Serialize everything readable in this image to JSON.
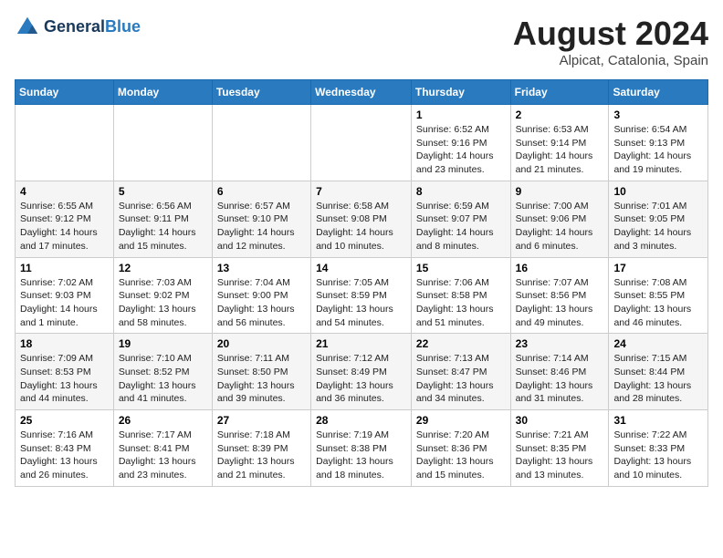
{
  "header": {
    "logo_general": "General",
    "logo_blue": "Blue",
    "month_year": "August 2024",
    "location": "Alpicat, Catalonia, Spain"
  },
  "days_of_week": [
    "Sunday",
    "Monday",
    "Tuesday",
    "Wednesday",
    "Thursday",
    "Friday",
    "Saturday"
  ],
  "weeks": [
    [
      {
        "day": "",
        "info": ""
      },
      {
        "day": "",
        "info": ""
      },
      {
        "day": "",
        "info": ""
      },
      {
        "day": "",
        "info": ""
      },
      {
        "day": "1",
        "info": "Sunrise: 6:52 AM\nSunset: 9:16 PM\nDaylight: 14 hours\nand 23 minutes."
      },
      {
        "day": "2",
        "info": "Sunrise: 6:53 AM\nSunset: 9:14 PM\nDaylight: 14 hours\nand 21 minutes."
      },
      {
        "day": "3",
        "info": "Sunrise: 6:54 AM\nSunset: 9:13 PM\nDaylight: 14 hours\nand 19 minutes."
      }
    ],
    [
      {
        "day": "4",
        "info": "Sunrise: 6:55 AM\nSunset: 9:12 PM\nDaylight: 14 hours\nand 17 minutes."
      },
      {
        "day": "5",
        "info": "Sunrise: 6:56 AM\nSunset: 9:11 PM\nDaylight: 14 hours\nand 15 minutes."
      },
      {
        "day": "6",
        "info": "Sunrise: 6:57 AM\nSunset: 9:10 PM\nDaylight: 14 hours\nand 12 minutes."
      },
      {
        "day": "7",
        "info": "Sunrise: 6:58 AM\nSunset: 9:08 PM\nDaylight: 14 hours\nand 10 minutes."
      },
      {
        "day": "8",
        "info": "Sunrise: 6:59 AM\nSunset: 9:07 PM\nDaylight: 14 hours\nand 8 minutes."
      },
      {
        "day": "9",
        "info": "Sunrise: 7:00 AM\nSunset: 9:06 PM\nDaylight: 14 hours\nand 6 minutes."
      },
      {
        "day": "10",
        "info": "Sunrise: 7:01 AM\nSunset: 9:05 PM\nDaylight: 14 hours\nand 3 minutes."
      }
    ],
    [
      {
        "day": "11",
        "info": "Sunrise: 7:02 AM\nSunset: 9:03 PM\nDaylight: 14 hours\nand 1 minute."
      },
      {
        "day": "12",
        "info": "Sunrise: 7:03 AM\nSunset: 9:02 PM\nDaylight: 13 hours\nand 58 minutes."
      },
      {
        "day": "13",
        "info": "Sunrise: 7:04 AM\nSunset: 9:00 PM\nDaylight: 13 hours\nand 56 minutes."
      },
      {
        "day": "14",
        "info": "Sunrise: 7:05 AM\nSunset: 8:59 PM\nDaylight: 13 hours\nand 54 minutes."
      },
      {
        "day": "15",
        "info": "Sunrise: 7:06 AM\nSunset: 8:58 PM\nDaylight: 13 hours\nand 51 minutes."
      },
      {
        "day": "16",
        "info": "Sunrise: 7:07 AM\nSunset: 8:56 PM\nDaylight: 13 hours\nand 49 minutes."
      },
      {
        "day": "17",
        "info": "Sunrise: 7:08 AM\nSunset: 8:55 PM\nDaylight: 13 hours\nand 46 minutes."
      }
    ],
    [
      {
        "day": "18",
        "info": "Sunrise: 7:09 AM\nSunset: 8:53 PM\nDaylight: 13 hours\nand 44 minutes."
      },
      {
        "day": "19",
        "info": "Sunrise: 7:10 AM\nSunset: 8:52 PM\nDaylight: 13 hours\nand 41 minutes."
      },
      {
        "day": "20",
        "info": "Sunrise: 7:11 AM\nSunset: 8:50 PM\nDaylight: 13 hours\nand 39 minutes."
      },
      {
        "day": "21",
        "info": "Sunrise: 7:12 AM\nSunset: 8:49 PM\nDaylight: 13 hours\nand 36 minutes."
      },
      {
        "day": "22",
        "info": "Sunrise: 7:13 AM\nSunset: 8:47 PM\nDaylight: 13 hours\nand 34 minutes."
      },
      {
        "day": "23",
        "info": "Sunrise: 7:14 AM\nSunset: 8:46 PM\nDaylight: 13 hours\nand 31 minutes."
      },
      {
        "day": "24",
        "info": "Sunrise: 7:15 AM\nSunset: 8:44 PM\nDaylight: 13 hours\nand 28 minutes."
      }
    ],
    [
      {
        "day": "25",
        "info": "Sunrise: 7:16 AM\nSunset: 8:43 PM\nDaylight: 13 hours\nand 26 minutes."
      },
      {
        "day": "26",
        "info": "Sunrise: 7:17 AM\nSunset: 8:41 PM\nDaylight: 13 hours\nand 23 minutes."
      },
      {
        "day": "27",
        "info": "Sunrise: 7:18 AM\nSunset: 8:39 PM\nDaylight: 13 hours\nand 21 minutes."
      },
      {
        "day": "28",
        "info": "Sunrise: 7:19 AM\nSunset: 8:38 PM\nDaylight: 13 hours\nand 18 minutes."
      },
      {
        "day": "29",
        "info": "Sunrise: 7:20 AM\nSunset: 8:36 PM\nDaylight: 13 hours\nand 15 minutes."
      },
      {
        "day": "30",
        "info": "Sunrise: 7:21 AM\nSunset: 8:35 PM\nDaylight: 13 hours\nand 13 minutes."
      },
      {
        "day": "31",
        "info": "Sunrise: 7:22 AM\nSunset: 8:33 PM\nDaylight: 13 hours\nand 10 minutes."
      }
    ]
  ]
}
